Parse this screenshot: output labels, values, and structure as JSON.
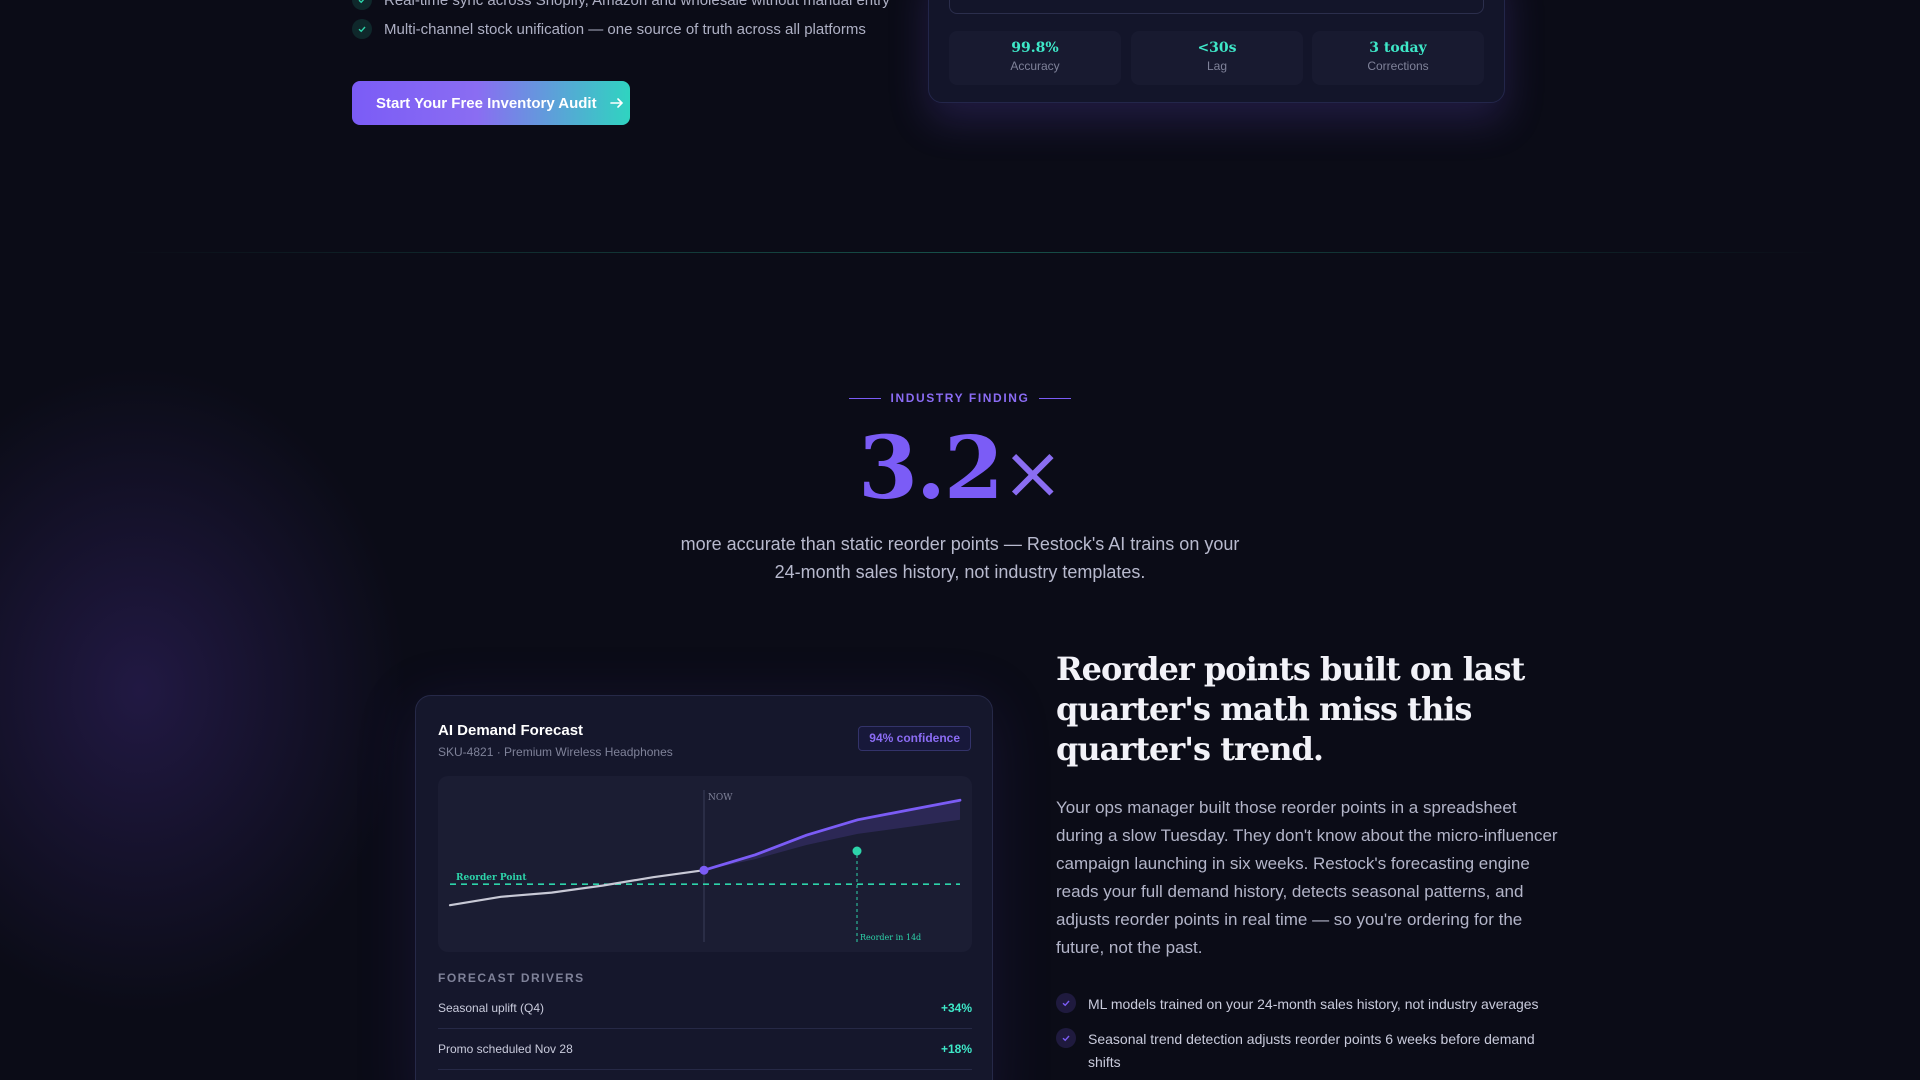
{
  "top": {
    "features": [
      {
        "text": "Real-time sync across Shopify, Amazon and wholesale without manual entry",
        "icon": "check-icon"
      },
      {
        "text": "Multi-channel stock unification — one source of truth across all platforms",
        "icon": "check-icon"
      }
    ],
    "cta_label": "Start Your Free Inventory Audit",
    "stats": [
      {
        "value": "99.8%",
        "label": "Accuracy"
      },
      {
        "value": "<30s",
        "label": "Lag"
      },
      {
        "value": "3 today",
        "label": "Corrections"
      }
    ]
  },
  "finding": {
    "eyebrow": "INDUSTRY FINDING",
    "stat_number": "3.2",
    "stat_suffix": "×",
    "line1": "more accurate than static reorder points — Restock's AI trains on your",
    "line2": "24-month sales history, not industry templates."
  },
  "forecast": {
    "title": "AI Demand Forecast",
    "subtitle": "SKU-4821 · Premium Wireless Headphones",
    "confidence": "94% confidence",
    "drivers_heading": "FORECAST DRIVERS",
    "drivers": [
      {
        "name": "Seasonal uplift (Q4)",
        "value": "+34%"
      },
      {
        "name": "Promo scheduled Nov 28",
        "value": "+18%"
      }
    ]
  },
  "chart_data": {
    "type": "line",
    "now_label": "NOW",
    "reorder_label": "Reorder Point",
    "reorder_in_label": "Reorder in 14d",
    "reorder_level": 0.37,
    "history": [
      0.22,
      0.28,
      0.31,
      0.36,
      0.42,
      0.47
    ],
    "forecast": [
      0.47,
      0.58,
      0.72,
      0.83,
      0.9,
      0.97
    ],
    "colors": {
      "history": "#c8c9d6",
      "forecast": "#7b5cf6",
      "reorder": "#2dd4aa"
    }
  },
  "copy": {
    "headline": "Reorder points built on last quarter's math miss this quarter's trend.",
    "body": "Your ops manager built those reorder points in a spreadsheet during a slow Tuesday. They don't know about the micro-influencer campaign launching in six weeks. Restock's forecasting engine reads your full demand history, detects seasonal patterns, and adjusts reorder points in real time — so you're ordering for the future, not the past.",
    "bullets": [
      "ML models trained on your 24-month sales history, not industry averages",
      "Seasonal trend detection adjusts reorder points 6 weeks before demand shifts"
    ]
  },
  "colors": {
    "accent": "#7b5cf6",
    "teal": "#2dd4aa",
    "background": "#0b0c17"
  }
}
